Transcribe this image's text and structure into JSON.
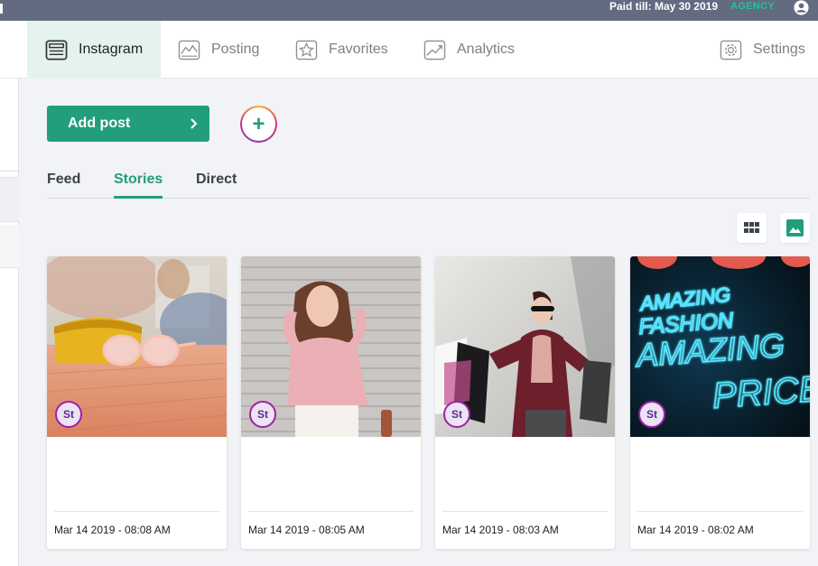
{
  "topbar": {
    "paid_text": "Paid till: May 30 2019",
    "plan": "AGENCY",
    "user_icon": "user-circle-icon",
    "colors": {
      "background": "#626b80",
      "plan": "#1ec79a"
    }
  },
  "nav": {
    "items": [
      {
        "label": "Instagram",
        "icon": "instagram-feed-icon",
        "active": true
      },
      {
        "label": "Posting",
        "icon": "posting-chart-icon",
        "active": false
      },
      {
        "label": "Favorites",
        "icon": "star-icon",
        "active": false
      },
      {
        "label": "Analytics",
        "icon": "analytics-trend-icon",
        "active": false
      },
      {
        "label": "Settings",
        "icon": "gear-icon",
        "active": false
      }
    ]
  },
  "actions": {
    "add_post_label": "Add post",
    "add_story_symbol": "+"
  },
  "tabs": [
    {
      "label": "Feed",
      "active": false
    },
    {
      "label": "Stories",
      "active": true
    },
    {
      "label": "Direct",
      "active": false
    }
  ],
  "view_toggle": {
    "grid_icon": "grid-view-icon",
    "image_icon": "image-view-icon"
  },
  "posts": [
    {
      "badge": "St",
      "date": "Mar 14 2019 - 08:08 AM",
      "image": "sunglasses-on-table-photo"
    },
    {
      "badge": "St",
      "date": "Mar 14 2019 - 08:05 AM",
      "image": "woman-pink-sweater-photo"
    },
    {
      "badge": "St",
      "date": "Mar 14 2019 - 08:03 AM",
      "image": "woman-shopping-bags-photo"
    },
    {
      "badge": "St",
      "date": "Mar 14 2019 - 08:02 AM",
      "image": "neon-amazing-fashion-sign-photo"
    }
  ],
  "neon_sign": {
    "line1": "AMAZING",
    "line2": "FASHION",
    "line3": "AMAZING",
    "line4": "PRICES"
  },
  "colors": {
    "accent": "#239e7c",
    "page_bg": "#f1f3f6",
    "badge_border": "#a21fa8"
  }
}
